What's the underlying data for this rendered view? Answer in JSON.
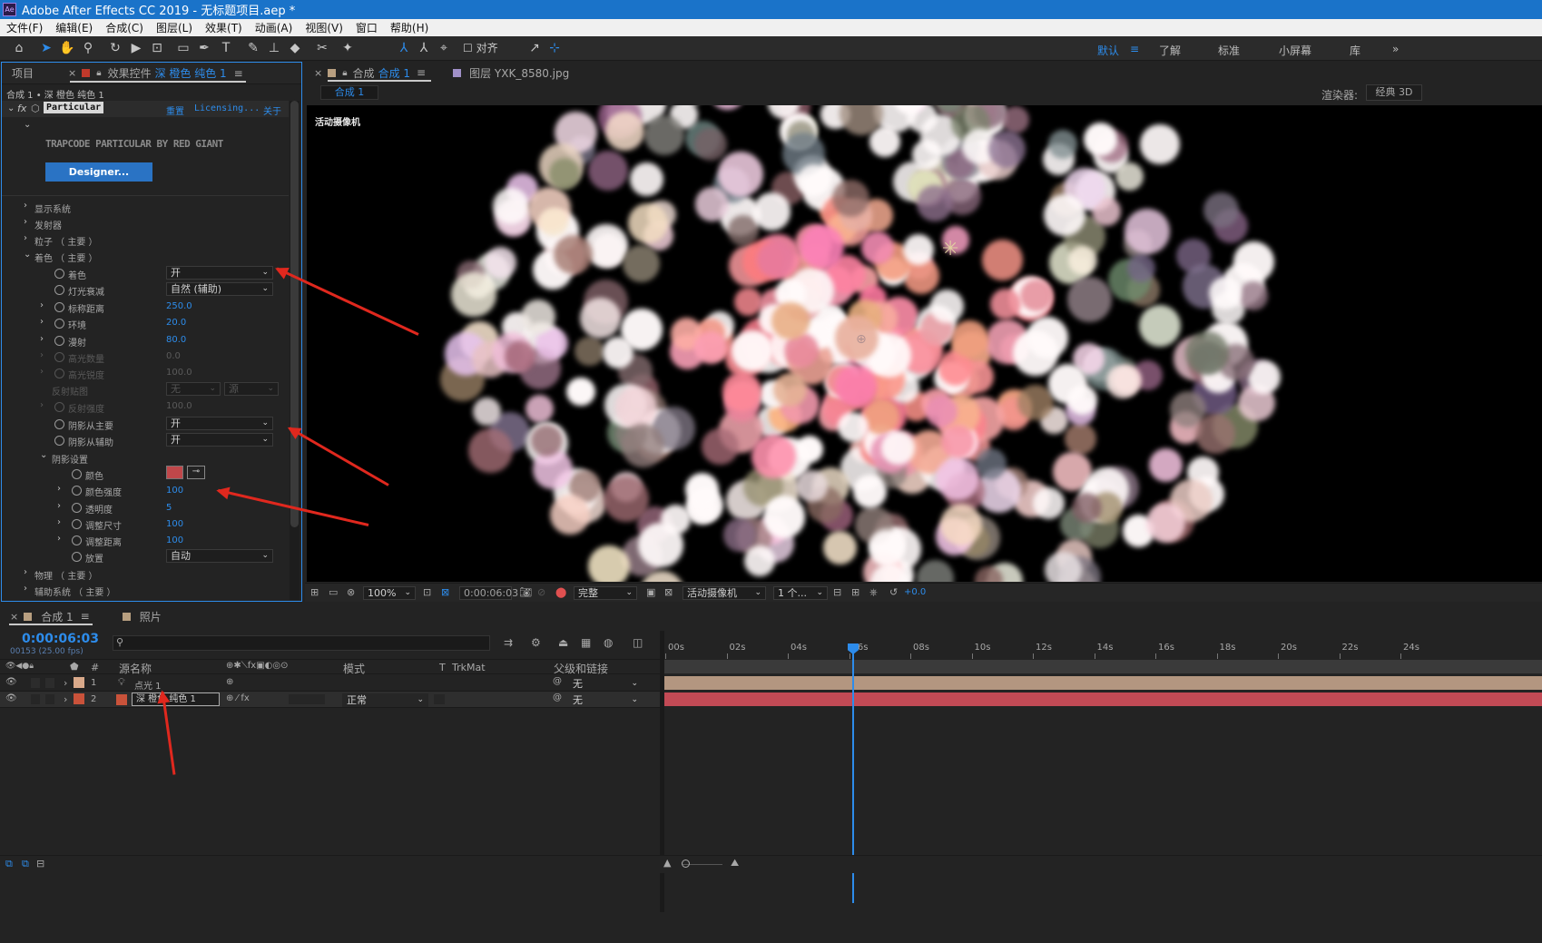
{
  "app": {
    "title": "Adobe After Effects CC 2019 - 无标题项目.aep *",
    "logo": "Ae"
  },
  "menu": [
    "文件(F)",
    "编辑(E)",
    "合成(C)",
    "图层(L)",
    "效果(T)",
    "动画(A)",
    "视图(V)",
    "窗口",
    "帮助(H)"
  ],
  "toolbar": {
    "snap_label": "对齐",
    "workspaces": [
      "默认",
      "了解",
      "标准",
      "小屏幕",
      "库"
    ],
    "active_workspace": "默认",
    "more": "»"
  },
  "left_panel": {
    "tab_project": "项目",
    "tab_effects_prefix": "效果控件",
    "tab_effects_layer": "深 橙色 纯色 1",
    "breadcrumb": "合成 1 • 深 橙色 纯色 1",
    "effect": {
      "fx": "fx",
      "name": "Particular",
      "reset": "重置",
      "licensing": "Licensing...",
      "about": "关于",
      "brand": "TRAPCODE PARTICULAR BY RED GIANT",
      "designer": "Designer..."
    },
    "groups": [
      "显示系统",
      "发射器",
      "粒子 （ 主要 ）",
      "着色 （ 主要 ）"
    ],
    "shading": {
      "p1": "着色",
      "v1": "开",
      "p2": "灯光衰减",
      "v2": "自然 (辅助)",
      "p3": "标称距离",
      "v3": "250.0",
      "p4": "环境",
      "v4": "20.0",
      "p5": "漫射",
      "v5": "80.0",
      "p6": "高光数量",
      "v6": "0.0",
      "p7": "高光锐度",
      "v7": "100.0",
      "p8": "反射贴图",
      "v8a": "无",
      "v8b": "源",
      "p9": "反射强度",
      "v9": "100.0",
      "p10": "阴影从主要",
      "v10": "开",
      "p11": "阴影从辅助",
      "v11": "开",
      "p12": "阴影设置"
    },
    "shadow": {
      "p1": "颜色",
      "color": "#c0474a",
      "p2": "颜色强度",
      "v2": "100",
      "p3": "透明度",
      "v3": "5",
      "p4": "调整尺寸",
      "v4": "100",
      "p5": "调整距离",
      "v5": "100",
      "p6": "放置",
      "v6": "自动"
    },
    "groups_after": [
      "物理 （ 主要 ）",
      "辅助系统 （ 主要 ）"
    ]
  },
  "comp_panel": {
    "tab_prefix": "合成",
    "tab_name": "合成 1",
    "menu": "≡",
    "layer_tab": "图层 YXK_8580.jpg",
    "sub_tab": "合成 1",
    "renderer_label": "渲染器:",
    "renderer": "经典 3D",
    "camera_label": "活动摄像机",
    "footer": {
      "zoom": "100%",
      "timecode": "0:00:06:03",
      "quality": "完整",
      "camera": "活动摄像机",
      "views": "1 个...",
      "exposure": "+0.0"
    }
  },
  "timeline": {
    "tab": "合成 1",
    "tab2": "照片",
    "timecode": "0:00:06:03",
    "frames": "00153 (25.00 fps)",
    "search_placeholder": "",
    "headers": {
      "num": "#",
      "source": "源名称",
      "mode": "模式",
      "t": "T",
      "trkmat": "TrkMat",
      "parent": "父级和链接"
    },
    "rows": [
      {
        "num": "1",
        "name": "点光 1",
        "color": "#d9a98a",
        "parent": "无",
        "mode": ""
      },
      {
        "num": "2",
        "name": "深 橙色 纯色 1",
        "color": "#c9523a",
        "parent": "无",
        "mode": "正常"
      }
    ],
    "ticks": [
      "00s",
      "02s",
      "04s",
      "06s",
      "08s",
      "10s",
      "12s",
      "14s",
      "16s",
      "18s",
      "20s",
      "22s",
      "24s"
    ],
    "bar1_color": "#b39680",
    "bar2_color": "#c24a55"
  }
}
